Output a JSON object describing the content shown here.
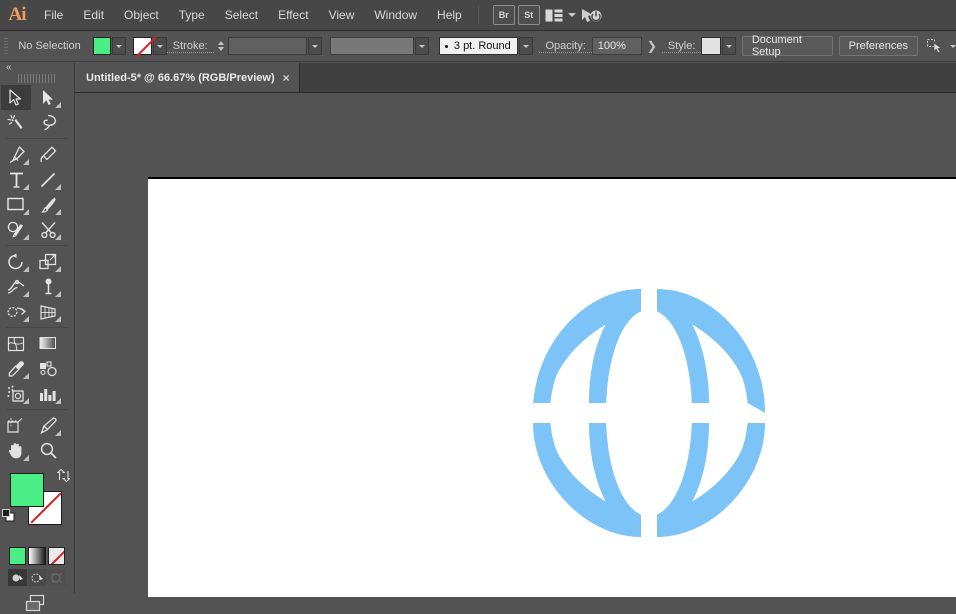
{
  "app": {
    "name": "Adobe Illustrator",
    "logo_text": "Ai"
  },
  "menubar": {
    "items": [
      {
        "label": "File"
      },
      {
        "label": "Edit"
      },
      {
        "label": "Object"
      },
      {
        "label": "Type"
      },
      {
        "label": "Select"
      },
      {
        "label": "Effect"
      },
      {
        "label": "View"
      },
      {
        "label": "Window"
      },
      {
        "label": "Help"
      }
    ],
    "bridge_badge": "Br",
    "stock_badge": "St",
    "arrange_icon": "arrange-documents-icon",
    "arrange_chevron": "chevron-down-icon",
    "stock_search_icon": "stock-search-icon"
  },
  "controlbar": {
    "selection_status": "No Selection",
    "fill_color": "#4aee84",
    "fill_icon": "fill-swatch",
    "stroke_color": "none",
    "stroke_icon": "stroke-swatch-none",
    "stroke_label": "Stroke:",
    "stroke_weight_value": "",
    "variable_width_value": "",
    "brush_label": "3 pt. Round",
    "opacity_label": "Opacity:",
    "opacity_value": "100%",
    "style_label": "Style:",
    "style_swatch": "#e2e2e2",
    "document_setup_label": "Document Setup",
    "preferences_label": "Preferences",
    "align_icon": "align-to-selection-icon"
  },
  "tabs": [
    {
      "title": "Untitled-5* @ 66.67% (RGB/Preview)",
      "close_label": "×",
      "active": true
    }
  ],
  "toolbar": {
    "collapse_label": "«",
    "tools": [
      {
        "name": "selection-tool",
        "selected": true,
        "submenu": false
      },
      {
        "name": "direct-selection-tool",
        "selected": false,
        "submenu": true
      },
      {
        "name": "magic-wand-tool",
        "selected": false,
        "submenu": false
      },
      {
        "name": "lasso-tool",
        "selected": false,
        "submenu": false
      },
      {
        "name": "pen-tool",
        "selected": false,
        "submenu": true
      },
      {
        "name": "curvature-tool",
        "selected": false,
        "submenu": false
      },
      {
        "name": "type-tool",
        "selected": false,
        "submenu": true
      },
      {
        "name": "line-segment-tool",
        "selected": false,
        "submenu": true
      },
      {
        "name": "rectangle-tool",
        "selected": false,
        "submenu": true
      },
      {
        "name": "paintbrush-tool",
        "selected": false,
        "submenu": true
      },
      {
        "name": "shaper-tool",
        "selected": false,
        "submenu": true
      },
      {
        "name": "scissors-tool",
        "selected": false,
        "submenu": true
      },
      {
        "name": "rotate-tool",
        "selected": false,
        "submenu": true
      },
      {
        "name": "scale-tool",
        "selected": false,
        "submenu": true
      },
      {
        "name": "width-tool",
        "selected": false,
        "submenu": true
      },
      {
        "name": "free-transform-tool",
        "selected": false,
        "submenu": true
      },
      {
        "name": "shape-builder-tool",
        "selected": false,
        "submenu": true
      },
      {
        "name": "perspective-grid-tool",
        "selected": false,
        "submenu": true
      },
      {
        "name": "mesh-tool",
        "selected": false,
        "submenu": false
      },
      {
        "name": "gradient-tool",
        "selected": false,
        "submenu": false
      },
      {
        "name": "eyedropper-tool",
        "selected": false,
        "submenu": true
      },
      {
        "name": "blend-tool",
        "selected": false,
        "submenu": false
      },
      {
        "name": "symbol-sprayer-tool",
        "selected": false,
        "submenu": true
      },
      {
        "name": "column-graph-tool",
        "selected": false,
        "submenu": true
      },
      {
        "name": "artboard-tool",
        "selected": false,
        "submenu": false
      },
      {
        "name": "slice-tool",
        "selected": false,
        "submenu": true
      },
      {
        "name": "hand-tool",
        "selected": false,
        "submenu": true
      },
      {
        "name": "zoom-tool",
        "selected": false,
        "submenu": false
      }
    ],
    "fill_color": "#4aee84",
    "stroke_color": "none",
    "swap_icon": "swap-fill-stroke-icon",
    "default_icon": "default-fill-stroke-icon",
    "mode_buttons": [
      {
        "name": "color-mode-button"
      },
      {
        "name": "gradient-mode-button"
      },
      {
        "name": "none-mode-button"
      }
    ],
    "draw_modes": [
      {
        "name": "draw-normal-button",
        "active": true,
        "disabled": false
      },
      {
        "name": "draw-behind-button",
        "active": false,
        "disabled": false
      },
      {
        "name": "draw-inside-button",
        "active": false,
        "disabled": true
      }
    ],
    "screen_mode": "change-screen-mode-button"
  },
  "canvas": {
    "artboard_background": "#ffffff",
    "artwork": {
      "name": "globe-icon-artwork",
      "color": "#7cc3f7",
      "description": "Globe / world wide web icon"
    }
  }
}
